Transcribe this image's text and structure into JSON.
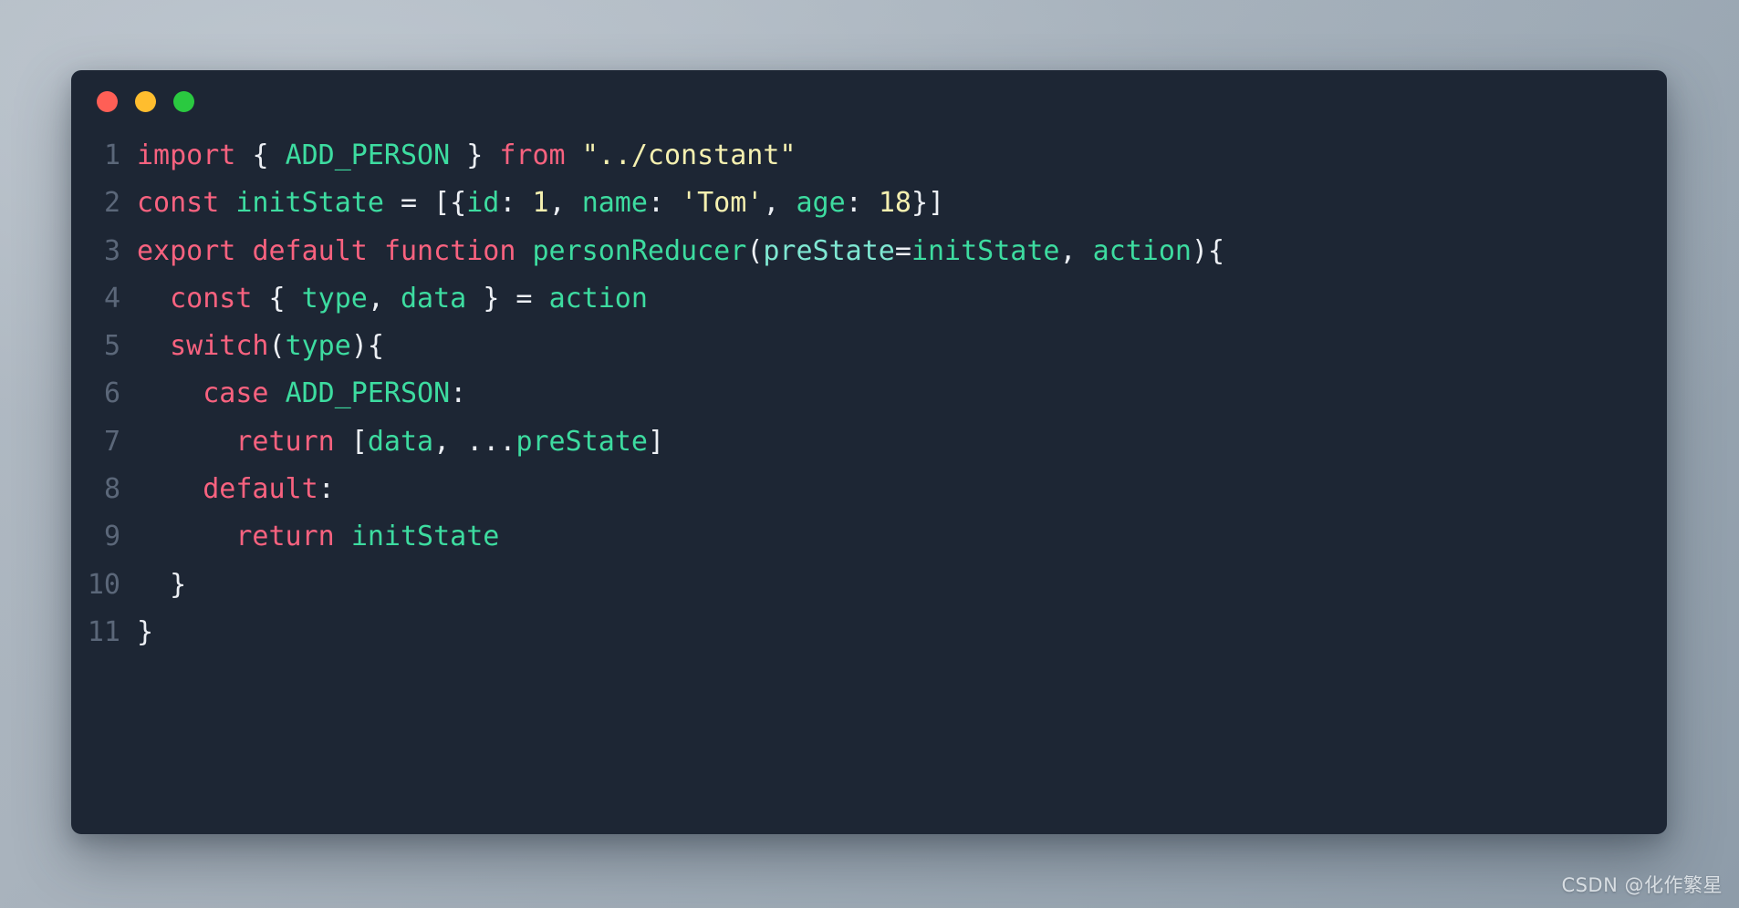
{
  "window": {
    "traffic_lights": [
      {
        "name": "close",
        "color": "#ff5f56"
      },
      {
        "name": "minimize",
        "color": "#ffbd2e"
      },
      {
        "name": "maximize",
        "color": "#2ac940"
      }
    ]
  },
  "theme": {
    "background": "#1d2634",
    "desktop": "#a4aeba",
    "line_number": "#5b6779",
    "keyword": "#f8627f",
    "identifier": "#3ddca0",
    "string": "#f5f0b0",
    "number": "#f5f0b0",
    "parameter": "#7fe7d2",
    "punctuation": "#eceff4"
  },
  "editor": {
    "language": "javascript",
    "plain_text": "import { ADD_PERSON } from \"../constant\"\nconst initState = [{id: 1, name: 'Tom', age: 18}]\nexport default function personReducer(preState=initState, action){\n  const { type, data } = action\n  switch(type){\n    case ADD_PERSON:\n      return [data, ...preState]\n    default:\n      return initState\n  }\n}",
    "lines": [
      {
        "number": "1",
        "tokens": [
          {
            "text": "import",
            "type": "kw"
          },
          {
            "text": " ",
            "type": "pun"
          },
          {
            "text": "{",
            "type": "pun"
          },
          {
            "text": " ",
            "type": "pun"
          },
          {
            "text": "ADD_PERSON",
            "type": "id"
          },
          {
            "text": " ",
            "type": "pun"
          },
          {
            "text": "}",
            "type": "pun"
          },
          {
            "text": " ",
            "type": "pun"
          },
          {
            "text": "from",
            "type": "kw"
          },
          {
            "text": " ",
            "type": "pun"
          },
          {
            "text": "\"../constant\"",
            "type": "str"
          }
        ]
      },
      {
        "number": "2",
        "tokens": [
          {
            "text": "const",
            "type": "kw"
          },
          {
            "text": " ",
            "type": "pun"
          },
          {
            "text": "initState",
            "type": "id"
          },
          {
            "text": " = [{",
            "type": "pun"
          },
          {
            "text": "id",
            "type": "prop"
          },
          {
            "text": ": ",
            "type": "pun"
          },
          {
            "text": "1",
            "type": "num"
          },
          {
            "text": ", ",
            "type": "pun"
          },
          {
            "text": "name",
            "type": "prop"
          },
          {
            "text": ": ",
            "type": "pun"
          },
          {
            "text": "'Tom'",
            "type": "str"
          },
          {
            "text": ", ",
            "type": "pun"
          },
          {
            "text": "age",
            "type": "prop"
          },
          {
            "text": ": ",
            "type": "pun"
          },
          {
            "text": "18",
            "type": "num"
          },
          {
            "text": "}]",
            "type": "pun"
          }
        ]
      },
      {
        "number": "3",
        "tokens": [
          {
            "text": "export",
            "type": "kw"
          },
          {
            "text": " ",
            "type": "pun"
          },
          {
            "text": "default",
            "type": "kw"
          },
          {
            "text": " ",
            "type": "pun"
          },
          {
            "text": "function",
            "type": "kw"
          },
          {
            "text": " ",
            "type": "pun"
          },
          {
            "text": "personReducer",
            "type": "fn"
          },
          {
            "text": "(",
            "type": "pun"
          },
          {
            "text": "preState",
            "type": "par"
          },
          {
            "text": "=",
            "type": "pun"
          },
          {
            "text": "initState",
            "type": "id"
          },
          {
            "text": ", ",
            "type": "pun"
          },
          {
            "text": "action",
            "type": "id"
          },
          {
            "text": "){",
            "type": "pun"
          }
        ]
      },
      {
        "number": "4",
        "tokens": [
          {
            "text": "  ",
            "type": "pun"
          },
          {
            "text": "const",
            "type": "kw"
          },
          {
            "text": " ",
            "type": "pun"
          },
          {
            "text": "{",
            "type": "pun"
          },
          {
            "text": " ",
            "type": "pun"
          },
          {
            "text": "type",
            "type": "id"
          },
          {
            "text": ", ",
            "type": "pun"
          },
          {
            "text": "data",
            "type": "id"
          },
          {
            "text": " ",
            "type": "pun"
          },
          {
            "text": "}",
            "type": "pun"
          },
          {
            "text": " = ",
            "type": "pun"
          },
          {
            "text": "action",
            "type": "id"
          }
        ]
      },
      {
        "number": "5",
        "tokens": [
          {
            "text": "  ",
            "type": "pun"
          },
          {
            "text": "switch",
            "type": "kw"
          },
          {
            "text": "(",
            "type": "pun"
          },
          {
            "text": "type",
            "type": "id"
          },
          {
            "text": "){",
            "type": "pun"
          }
        ]
      },
      {
        "number": "6",
        "tokens": [
          {
            "text": "    ",
            "type": "pun"
          },
          {
            "text": "case",
            "type": "kw"
          },
          {
            "text": " ",
            "type": "pun"
          },
          {
            "text": "ADD_PERSON",
            "type": "id"
          },
          {
            "text": ":",
            "type": "pun"
          }
        ]
      },
      {
        "number": "7",
        "tokens": [
          {
            "text": "      ",
            "type": "pun"
          },
          {
            "text": "return",
            "type": "kw"
          },
          {
            "text": " [",
            "type": "pun"
          },
          {
            "text": "data",
            "type": "id"
          },
          {
            "text": ", ",
            "type": "pun"
          },
          {
            "text": "...",
            "type": "pun"
          },
          {
            "text": "preState",
            "type": "id"
          },
          {
            "text": "]",
            "type": "pun"
          }
        ]
      },
      {
        "number": "8",
        "tokens": [
          {
            "text": "    ",
            "type": "pun"
          },
          {
            "text": "default",
            "type": "kw"
          },
          {
            "text": ":",
            "type": "pun"
          }
        ]
      },
      {
        "number": "9",
        "tokens": [
          {
            "text": "      ",
            "type": "pun"
          },
          {
            "text": "return",
            "type": "kw"
          },
          {
            "text": " ",
            "type": "pun"
          },
          {
            "text": "initState",
            "type": "id"
          }
        ]
      },
      {
        "number": "10",
        "tokens": [
          {
            "text": "  ",
            "type": "pun"
          },
          {
            "text": "}",
            "type": "pun"
          }
        ]
      },
      {
        "number": "11",
        "tokens": [
          {
            "text": "}",
            "type": "pun"
          }
        ]
      }
    ]
  },
  "watermark": {
    "text": "CSDN @化作繁星"
  }
}
